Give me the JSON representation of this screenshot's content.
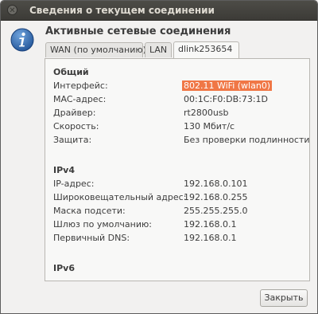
{
  "window": {
    "title": "Сведения о текущем соединении"
  },
  "header": {
    "heading": "Активные сетевые соединения"
  },
  "tabs": [
    {
      "label": "WAN (по умолчанию)"
    },
    {
      "label": "LAN"
    },
    {
      "label": "dlink253654"
    }
  ],
  "general": {
    "title": "Общий",
    "rows": [
      {
        "label": "Интерфейс:",
        "value": "802.11 WiFi (wlan0)"
      },
      {
        "label": "MAC-адрес:",
        "value": "00:1C:F0:DB:73:1D"
      },
      {
        "label": "Драйвер:",
        "value": "rt2800usb"
      },
      {
        "label": "Скорость:",
        "value": "130 Мбит/с"
      },
      {
        "label": "Защита:",
        "value": "Без проверки подлинности"
      }
    ]
  },
  "ipv4": {
    "title": "IPv4",
    "rows": [
      {
        "label": "IP-адрес:",
        "value": "192.168.0.101"
      },
      {
        "label": "Широковещательный адрес:",
        "value": "192.168.0.255"
      },
      {
        "label": "Маска подсети:",
        "value": "255.255.255.0"
      },
      {
        "label": "Шлюз по умолчанию:",
        "value": "192.168.0.1"
      },
      {
        "label": "Первичный DNS:",
        "value": "192.168.0.1"
      }
    ]
  },
  "ipv6": {
    "title": "IPv6"
  },
  "footer": {
    "close_label": "Закрыть"
  },
  "colors": {
    "highlight": "#f07746",
    "titlebar": "#3c3b37"
  },
  "icons": {
    "close": "close-icon",
    "info": "info-icon"
  }
}
